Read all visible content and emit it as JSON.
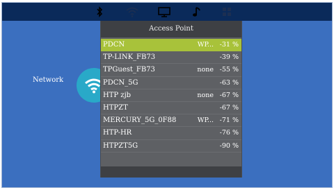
{
  "topbar": {
    "icons": [
      "bluetooth-icon",
      "wifi-icon",
      "monitor-icon",
      "music-note-icon",
      "apps-grid-icon"
    ],
    "background": "#0a2a5a"
  },
  "sidebar": {
    "network_label": "Network"
  },
  "access_point_panel": {
    "title": "Access Point",
    "selected_index": 0,
    "selected_color": "#a8c23a",
    "networks": [
      {
        "ssid": "PDCN",
        "security": "WP...",
        "signal": "-31 %"
      },
      {
        "ssid": "TP-LINK_FB73",
        "security": "",
        "signal": "-39 %"
      },
      {
        "ssid": "TPGuest_FB73",
        "security": "none",
        "signal": "-55 %"
      },
      {
        "ssid": "PDCN_5G",
        "security": "",
        "signal": "-63 %"
      },
      {
        "ssid": "HTP zjb",
        "security": "none",
        "signal": "-67 %"
      },
      {
        "ssid": "HTPZT",
        "security": "",
        "signal": "-67 %"
      },
      {
        "ssid": "MERCURY_5G_0F88",
        "security": "WP...",
        "signal": "-71 %"
      },
      {
        "ssid": "HTP-HR",
        "security": "",
        "signal": "-76 %"
      },
      {
        "ssid": "HTPZT5G",
        "security": "",
        "signal": "-90 %"
      }
    ]
  },
  "colors": {
    "screen_background": "#3b6fbf",
    "wifi_circle": "#29a9c8"
  }
}
